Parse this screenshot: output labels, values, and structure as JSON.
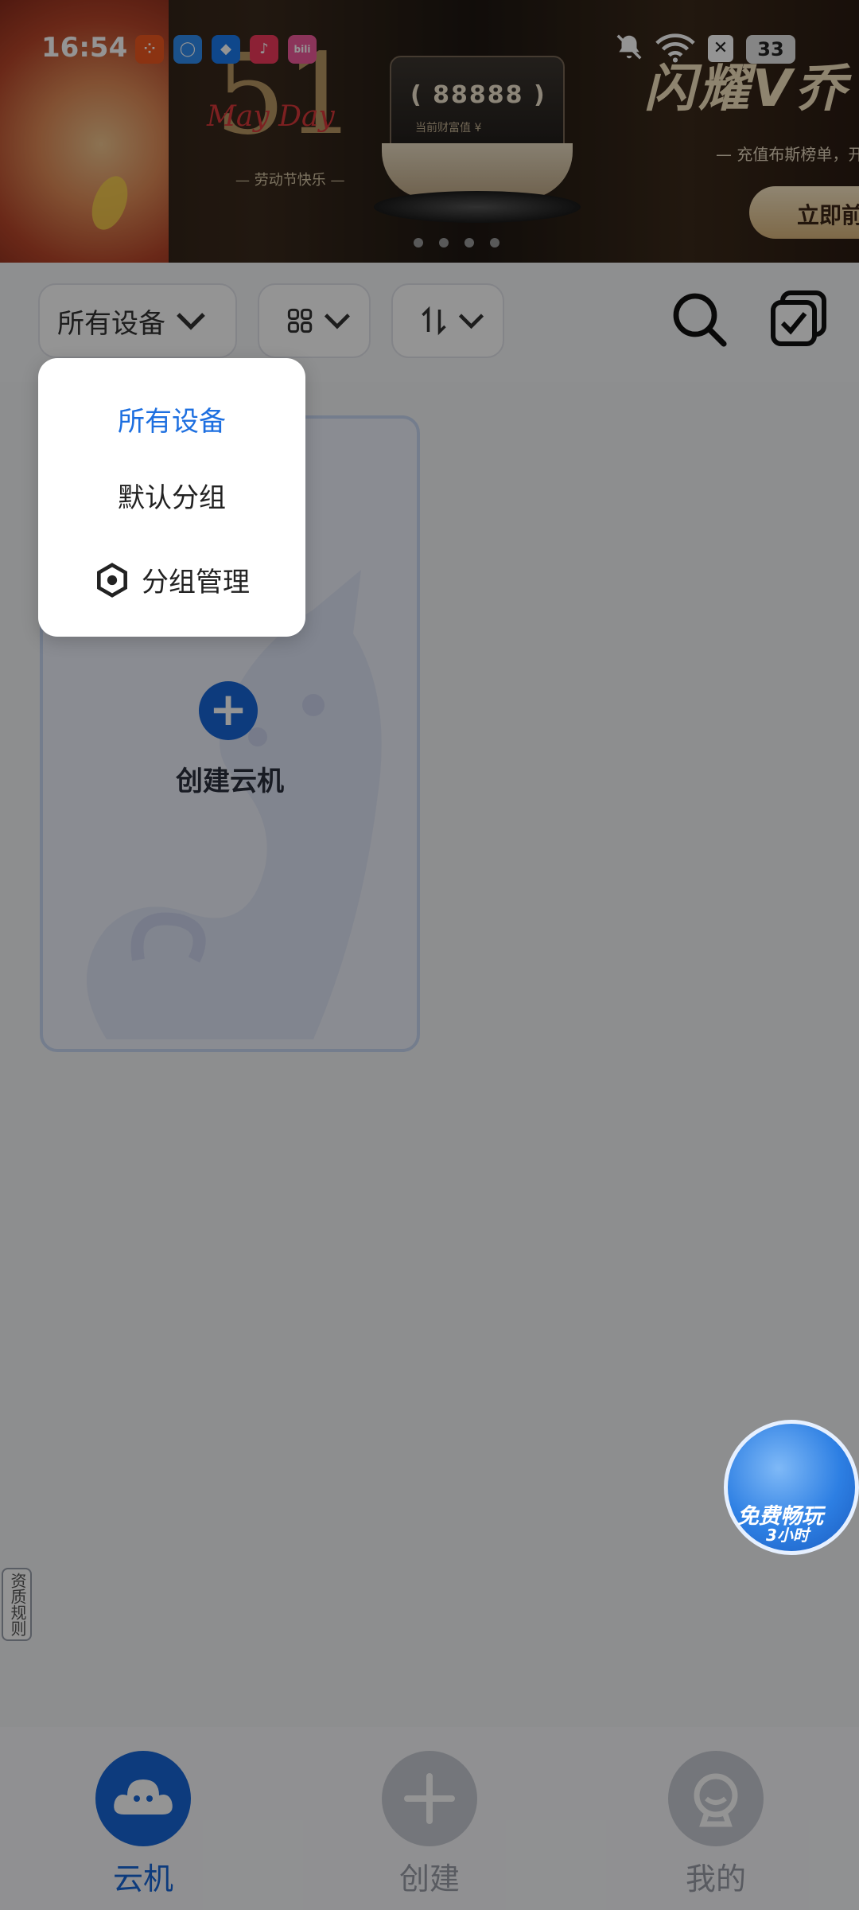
{
  "status_bar": {
    "time": "16:54",
    "notification_app_icons": [
      "app-orange-icon",
      "app-blue-circle-icon",
      "app-blue-browser-icon",
      "music-icon",
      "bilibili-icon"
    ],
    "battery": "33",
    "icons": [
      "mute-bell-icon",
      "wifi-icon",
      "x-box-icon",
      "battery-icon"
    ]
  },
  "banner": {
    "event_number": "51",
    "event_title": "May Day",
    "event_subtitle": "— 劳动节快乐 —",
    "card_value": "( 88888 )",
    "card_caption": "当前财富值 ¥",
    "headline": "闪耀V乔",
    "subline": "— 充值布斯榜单，开",
    "cta": "立即前"
  },
  "filter_bar": {
    "group_filter": "所有设备",
    "view_icon": "grid-view-icon",
    "sort_icon": "sort-icon"
  },
  "content": {
    "create_card_label": "创建云机"
  },
  "dropdown": {
    "items": [
      {
        "label": "所有设备",
        "active": true
      },
      {
        "label": "默认分组",
        "active": false
      }
    ],
    "manage_label": "分组管理"
  },
  "floating_promo": {
    "line1": "免费畅玩",
    "line2": "3小时"
  },
  "side_tag": "资质规则",
  "bottom_nav": {
    "items": [
      {
        "label": "云机",
        "active": true,
        "icon": "cloud-phone-icon"
      },
      {
        "label": "创建",
        "active": false,
        "icon": "plus-icon"
      },
      {
        "label": "我的",
        "active": false,
        "icon": "profile-icon"
      }
    ]
  },
  "colors": {
    "accent": "#1766D8",
    "active_text": "#1D6FE0",
    "overlay": "rgba(0,0,0,0.42)"
  }
}
